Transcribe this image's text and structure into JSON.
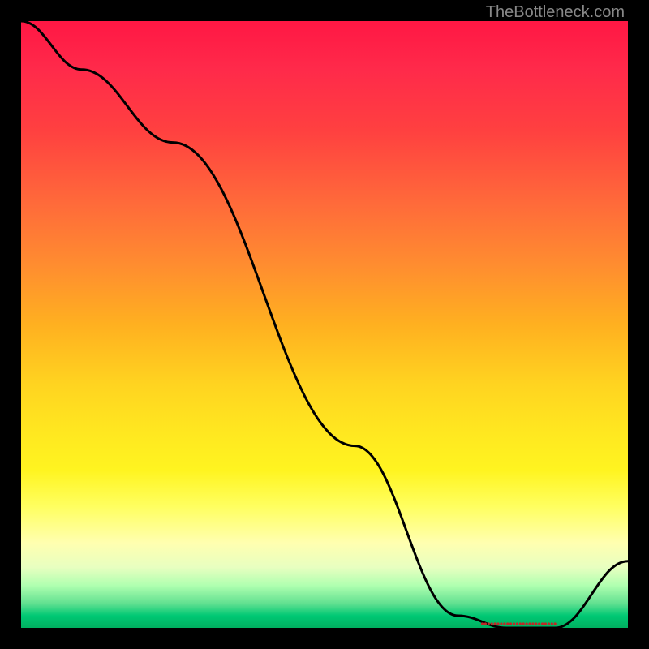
{
  "watermark": "TheBottleneck.com",
  "marker_label": "",
  "chart_data": {
    "type": "line",
    "title": "",
    "xlabel": "",
    "ylabel": "",
    "xlim": [
      0,
      100
    ],
    "ylim": [
      0,
      100
    ],
    "grid": false,
    "legend": false,
    "series": [
      {
        "name": "curve",
        "x": [
          0,
          10,
          25,
          55,
          72,
          80,
          88,
          100
        ],
        "values": [
          100,
          92,
          80,
          30,
          2,
          0,
          0,
          11
        ]
      }
    ],
    "marker": {
      "x_range": [
        76,
        88
      ],
      "y": 0
    },
    "notes": "Black curve over a vertical red→orange→yellow→green gradient. Y values are approximate, read as percentage height from bottom."
  }
}
